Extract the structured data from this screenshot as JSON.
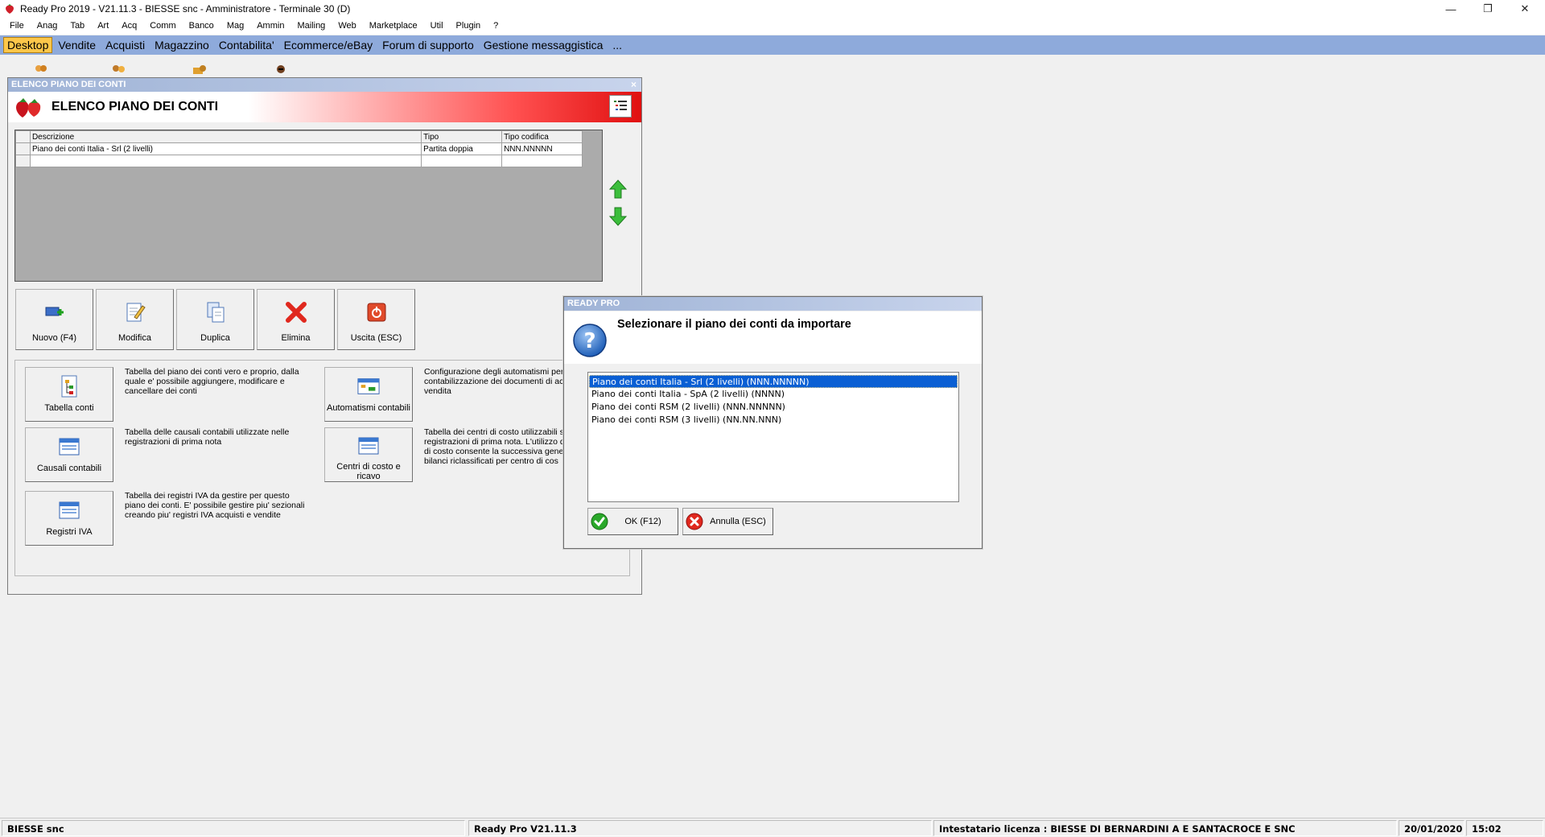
{
  "window": {
    "title": "Ready Pro 2019 - V21.11.3 - BIESSE snc - Amministratore - Terminale 30 (D)",
    "minimize_glyph": "—",
    "restore_glyph": "❐",
    "close_glyph": "✕"
  },
  "menu": [
    "File",
    "Anag",
    "Tab",
    "Art",
    "Acq",
    "Comm",
    "Banco",
    "Mag",
    "Ammin",
    "Mailing",
    "Web",
    "Marketplace",
    "Util",
    "Plugin",
    "?"
  ],
  "tabs": [
    {
      "label": "Desktop",
      "active": true
    },
    {
      "label": "Vendite"
    },
    {
      "label": "Acquisti"
    },
    {
      "label": "Magazzino"
    },
    {
      "label": "Contabilita'"
    },
    {
      "label": "Ecommerce/eBay"
    },
    {
      "label": "Forum di supporto"
    },
    {
      "label": "Gestione messaggistica"
    },
    {
      "label": "..."
    }
  ],
  "piano_window": {
    "caption": "ELENCO PIANO DEI CONTI",
    "close_glyph": "×",
    "header_title": "ELENCO PIANO DEI CONTI",
    "grid": {
      "columns": [
        "Descrizione",
        "Tipo",
        "Tipo codifica"
      ],
      "rows": [
        [
          "Piano dei conti Italia - Srl (2 livelli)",
          "Partita doppia",
          "NNN.NNNNN"
        ]
      ]
    },
    "toolbar": {
      "nuovo": "Nuovo (F4)",
      "modifica": "Modifica",
      "duplica": "Duplica",
      "elimina": "Elimina",
      "uscita": "Uscita (ESC)"
    },
    "links": {
      "tabella_conti": {
        "label": "Tabella conti",
        "desc": "Tabella del piano dei conti vero e proprio, dalla quale e' possibile aggiungere, modificare e cancellare dei conti"
      },
      "causali": {
        "label": "Causali contabili",
        "desc": "Tabella delle causali contabili utilizzate nelle registrazioni di prima nota"
      },
      "registri": {
        "label": "Registri IVA",
        "desc": "Tabella dei registri IVA da gestire per questo piano dei conti. E' possibile gestire piu' sezionali creando piu' registri IVA acquisti e vendite"
      },
      "automatismi": {
        "label": "Automatismi contabili",
        "desc": "Configurazione degli automatismi per contabilizzazione dei documenti di acq vendita"
      },
      "centri": {
        "label": "Centri di costo e ricavo",
        "desc": "Tabella dei centri di costo utilizzabili su registrazioni di prima nota. L'utilizzo di di costo consente la successiva gener di bilanci riclassificati per centro di cos"
      }
    }
  },
  "dialog": {
    "caption": "READY PRO",
    "title": "Selezionare il piano dei conti da importare",
    "options": [
      "Piano dei conti Italia - Srl (2 livelli) (NNN.NNNNN)",
      "Piano dei conti Italia - SpA (2 livelli) (NNNN)",
      "Piano dei conti RSM (2 livelli) (NNN.NNNNN)",
      "Piano dei conti RSM (3 livelli) (NN.NN.NNN)"
    ],
    "selected_index": 0,
    "ok_label": "OK (F12)",
    "cancel_label": "Annulla (ESC)"
  },
  "status": {
    "company": "BIESSE snc",
    "version": "Ready Pro V21.11.3",
    "license": "Intestatario licenza : BIESSE DI BERNARDINI A E SANTACROCE E SNC",
    "date": "20/01/2020",
    "time": "15:02"
  },
  "colors": {
    "tabbar": "#8eaadb",
    "active_tab": "#fdc74a",
    "header_red": "#e01010",
    "selection": "#0a5fd4"
  }
}
